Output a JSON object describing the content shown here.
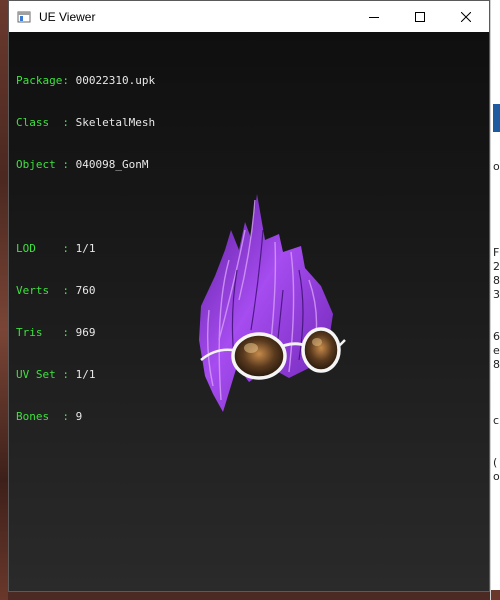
{
  "window": {
    "title": "UE Viewer",
    "app_icon": "window-icon",
    "controls": {
      "minimize_icon": "minimize-icon",
      "maximize_icon": "maximize-icon",
      "close_icon": "close-icon"
    }
  },
  "info_top": [
    {
      "key": "Package:",
      "value": "00022310.upk"
    },
    {
      "key": "Class  :",
      "value": "SkeletalMesh"
    },
    {
      "key": "Object :",
      "value": "040098_GonM"
    }
  ],
  "info_bottom": [
    {
      "key": "LOD    :",
      "value": "1/1"
    },
    {
      "key": "Verts  :",
      "value": "760"
    },
    {
      "key": "Tris   :",
      "value": "969"
    },
    {
      "key": "UV Set :",
      "value": "1/1"
    },
    {
      "key": "Bones  :",
      "value": "9"
    }
  ],
  "colors": {
    "label_green": "#3fe03f",
    "value_white": "#e8e8e8",
    "hair_purple": "#9b3ee0"
  },
  "background_window_fragments": [
    "o",
    "F",
    "2",
    "8",
    "3",
    "6",
    "e",
    "8",
    "c",
    "(",
    "o"
  ]
}
